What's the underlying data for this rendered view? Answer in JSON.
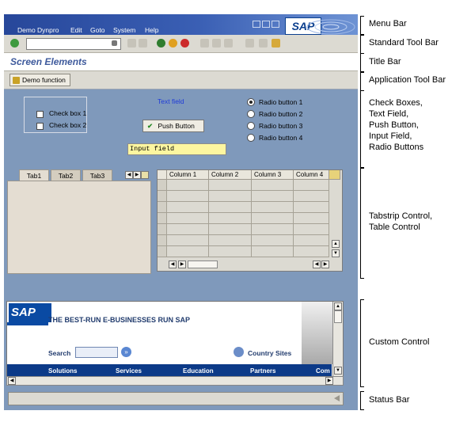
{
  "menu_bar": {
    "items": [
      "Demo Dynpro",
      "Edit",
      "Goto",
      "System",
      "Help"
    ],
    "logo": "SAP"
  },
  "standard_toolbar": {
    "icons": [
      "enter-icon",
      "command-field",
      "back-icon",
      "save-icon",
      "back-arrow-icon",
      "exit-icon",
      "cancel-icon",
      "print-icon",
      "find-icon",
      "find-next-icon",
      "first-page-icon",
      "last-page-icon",
      "new-session-icon",
      "shortcut-icon",
      "help-icon"
    ]
  },
  "title_bar": {
    "title": "Screen Elements"
  },
  "application_toolbar": {
    "demo_function_label": "Demo function"
  },
  "elements": {
    "checkbox_1": "Check box 1",
    "checkbox_2": "Check box 2",
    "text_field": "Text field",
    "push_button": "Push Button",
    "input_field": "Input field",
    "radio_1": "Radio button 1",
    "radio_2": "Radio button 2",
    "radio_3": "Radio button 3",
    "radio_4": "Radio button 4"
  },
  "tabstrip": {
    "tabs": [
      "Tab1",
      "Tab2",
      "Tab3"
    ]
  },
  "table_control": {
    "columns": [
      "Column 1",
      "Column 2",
      "Column 3",
      "Column 4"
    ]
  },
  "custom_control": {
    "logo": "SAP",
    "slogan": "THE BEST-RUN E-BUSINESSES RUN SAP",
    "search_label": "Search",
    "country_sites": "Country Sites",
    "nav": [
      "Solutions",
      "Services",
      "Education",
      "Partners",
      "Com"
    ]
  },
  "callouts": {
    "menu_bar": "Menu Bar",
    "standard_toolbar": "Standard Tool Bar",
    "title_bar": "Title Bar",
    "application_toolbar": "Application Tool Bar",
    "elements_1": "Check Boxes,",
    "elements_2": "Text Field,",
    "elements_3": "Push Button,",
    "elements_4": "Input Field,",
    "elements_5": "Radio Buttons",
    "controls_1": "Tabstrip Control,",
    "controls_2": "Table Control",
    "custom_control": "Custom Control",
    "status_bar": "Status Bar"
  },
  "colors": {
    "menu_bar_bg": "#2f52a8",
    "window_bg": "#7f99bb",
    "toolbar_bg": "#dcdad2",
    "input_field_bg": "#fdf6a0",
    "text_field_color": "#1f3bd8",
    "web_nav_bg": "#0c3a88"
  }
}
